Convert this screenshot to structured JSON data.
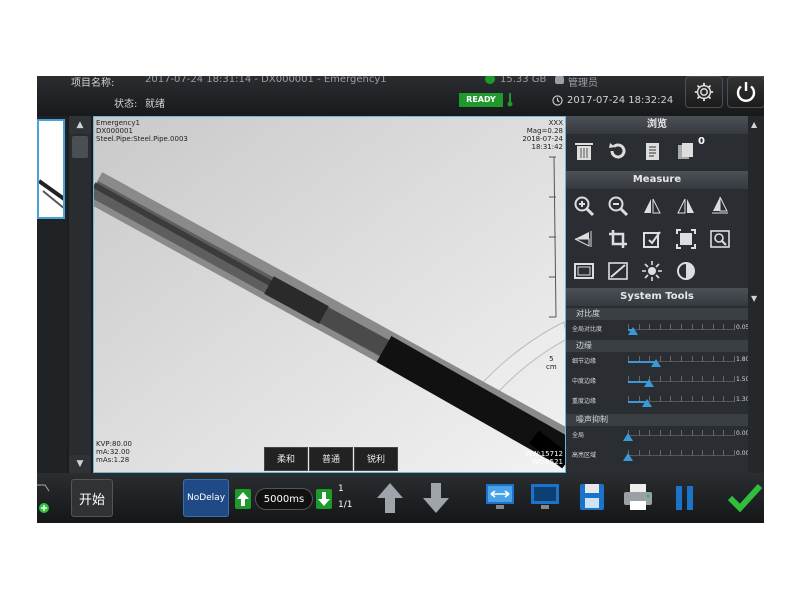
{
  "header": {
    "project_label": "项目名称:",
    "project_value": "2017-07-24 18:31:14 - DX000001 - Emergency1",
    "disk_space": "15.33 GB",
    "user": "管理员",
    "status_label": "状态:",
    "status_value": "就绪",
    "ready_badge": "READY",
    "datetime": "2017-07-24 18:32:24"
  },
  "viewer": {
    "overlay_tl": [
      "Emergency1",
      "DX000001",
      "Steel.Pipe:Steel.Pipe.0003"
    ],
    "overlay_tr": [
      "XXX",
      "Mag=0.28",
      "2018-07-24",
      "18:31:42"
    ],
    "overlay_bl": [
      "KVP:80.00",
      "mA:32.00",
      "mAs:1.28"
    ],
    "overlay_br": [
      "WW:15712",
      "WL:8521"
    ],
    "scale_label": "5",
    "scale_unit": "cm",
    "filters": [
      "柔和",
      "普通",
      "锐利"
    ]
  },
  "panel": {
    "browse_title": "浏览",
    "copy_count": "0",
    "measure_title": "Measure",
    "system_tools_title": "System Tools",
    "contrast_title": "对比度",
    "contrast_sliders": [
      {
        "label": "全局对比度",
        "value": "0.05",
        "level": 0.05
      }
    ],
    "edge_title": "边缘",
    "edge_sliders": [
      {
        "label": "细节边缘",
        "value": "1.80",
        "level": 0.26
      },
      {
        "label": "中度边缘",
        "value": "1.50",
        "level": 0.2
      },
      {
        "label": "重度边缘",
        "value": "1.30",
        "level": 0.18
      }
    ],
    "noise_title": "噪声抑制",
    "noise_sliders": [
      {
        "label": "全局",
        "value": "0.00",
        "level": 0.0
      },
      {
        "label": "高亮区域",
        "value": "0.00",
        "level": 0.0
      }
    ]
  },
  "bottom": {
    "start_label": "开始",
    "nodelay_label": "NoDelay",
    "delay_value": "5000ms",
    "page_index": "1",
    "page_total": "1/1"
  },
  "colors": {
    "accent_blue": "#3a9ad9",
    "ready_green": "#1e9a2c",
    "confirm_green": "#2fbf3a"
  }
}
